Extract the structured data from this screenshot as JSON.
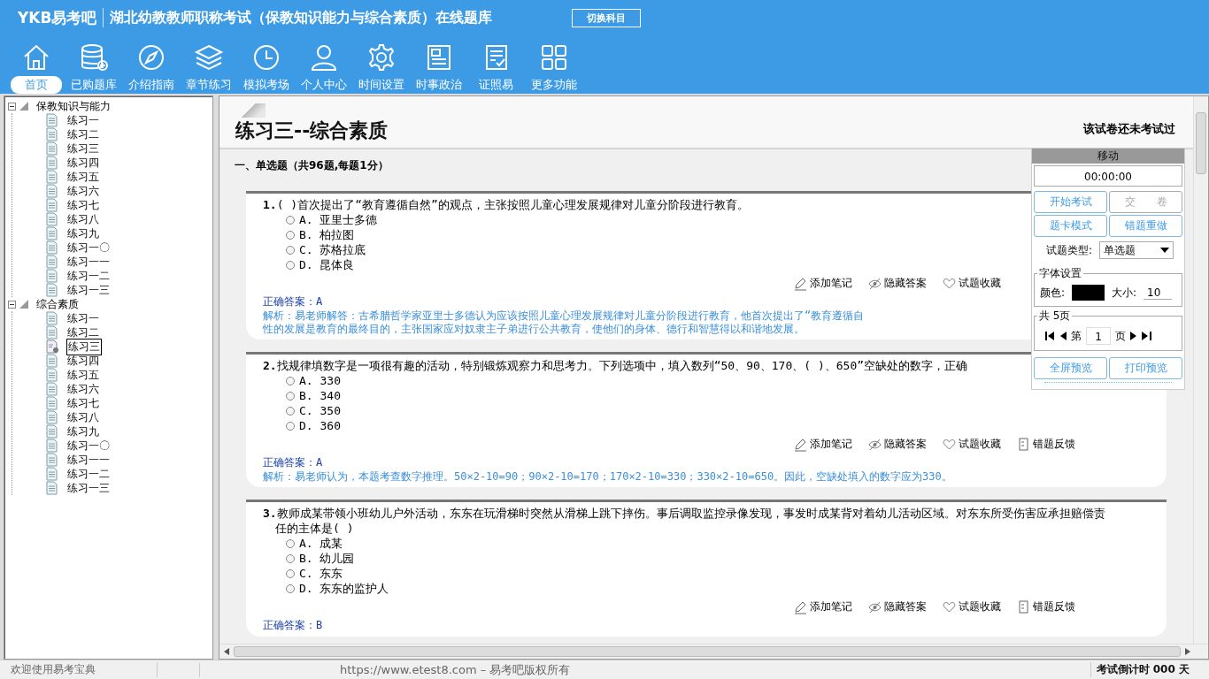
{
  "header": {
    "logo": "YKB易考吧",
    "title": "湖北幼教教师职称考试（保教知识能力与综合素质）在线题库",
    "switch_button": "切换科目"
  },
  "nav": [
    {
      "label": "首页",
      "selected": true
    },
    {
      "label": "已购题库",
      "selected": false
    },
    {
      "label": "介绍指南",
      "selected": false
    },
    {
      "label": "章节练习",
      "selected": false
    },
    {
      "label": "模拟考场",
      "selected": false
    },
    {
      "label": "个人中心",
      "selected": false
    },
    {
      "label": "时间设置",
      "selected": false
    },
    {
      "label": "时事政治",
      "selected": false
    },
    {
      "label": "证照易",
      "selected": false
    },
    {
      "label": "更多功能",
      "selected": false
    }
  ],
  "tree": [
    {
      "label": "保教知识与能力",
      "expanded": true,
      "children": [
        {
          "label": "练习一",
          "selected": false
        },
        {
          "label": "练习二",
          "selected": false
        },
        {
          "label": "练习三",
          "selected": false
        },
        {
          "label": "练习四",
          "selected": false
        },
        {
          "label": "练习五",
          "selected": false
        },
        {
          "label": "练习六",
          "selected": false
        },
        {
          "label": "练习七",
          "selected": false
        },
        {
          "label": "练习八",
          "selected": false
        },
        {
          "label": "练习九",
          "selected": false
        },
        {
          "label": "练习一〇",
          "selected": false
        },
        {
          "label": "练习一一",
          "selected": false
        },
        {
          "label": "练习一二",
          "selected": false
        },
        {
          "label": "练习一三",
          "selected": false
        }
      ]
    },
    {
      "label": "综合素质",
      "expanded": true,
      "children": [
        {
          "label": "练习一",
          "selected": false
        },
        {
          "label": "练习二",
          "selected": false
        },
        {
          "label": "练习三",
          "selected": true
        },
        {
          "label": "练习四",
          "selected": false
        },
        {
          "label": "练习五",
          "selected": false
        },
        {
          "label": "练习六",
          "selected": false
        },
        {
          "label": "练习七",
          "selected": false
        },
        {
          "label": "练习八",
          "selected": false
        },
        {
          "label": "练习九",
          "selected": false
        },
        {
          "label": "练习一〇",
          "selected": false
        },
        {
          "label": "练习一一",
          "selected": false
        },
        {
          "label": "练习一二",
          "selected": false
        },
        {
          "label": "练习一三",
          "selected": false
        }
      ]
    }
  ],
  "paper": {
    "title": "练习三--综合素质",
    "status": "该试卷还未考试过",
    "section": "一、单选题（共96题,每题1分）"
  },
  "questions": [
    {
      "number": "1.",
      "stem": "( )首次提出了“教育遵循自然”的观点，主张按照儿童心理发展规律对儿童分阶段进行教育。",
      "options": [
        {
          "label": "A. 亚里士多德",
          "selected": false
        },
        {
          "label": "B. 柏拉图",
          "selected": false
        },
        {
          "label": "C. 苏格拉底",
          "selected": false
        },
        {
          "label": "D. 昆体良",
          "selected": false
        }
      ],
      "actions": [
        "添加笔记",
        "隐藏答案",
        "试题收藏"
      ],
      "answer": "正确答案：A",
      "analysis": [
        "解析：易老师解答：古希腊哲学家亚里士多德认为应该按照儿童心理发展规律对儿童分阶段进行教育，他首次提出了“教育遵循自",
        "性的发展是教育的最终目的，主张国家应对奴隶主子弟进行公共教育，使他们的身体、德行和智慧得以和谐地发展。"
      ]
    },
    {
      "number": "2.",
      "stem": "找规律填数字是一项很有趣的活动，特别锻炼观察力和思考力。下列选项中，填入数列“50、90、170、( )、650”空缺处的数字，正确",
      "options": [
        {
          "label": "A. 330",
          "selected": false
        },
        {
          "label": "B. 340",
          "selected": false
        },
        {
          "label": "C. 350",
          "selected": false
        },
        {
          "label": "D. 360",
          "selected": false
        }
      ],
      "actions": [
        "添加笔记",
        "隐藏答案",
        "试题收藏",
        "错题反馈"
      ],
      "answer": "正确答案：A",
      "analysis": [
        "解析：易老师认为，本题考查数字推理。50×2-10=90；90×2-10=170；170×2-10=330；330×2-10=650。因此，空缺处填入的数字应为330。"
      ]
    },
    {
      "number": "3.",
      "stem": "教师成某带领小班幼儿户外活动，东东在玩滑梯时突然从滑梯上跳下摔伤。事后调取监控录像发现，事发时成某背对着幼儿活动区域。对东东所受伤害应承担赔偿责任的主体是( )",
      "options": [
        {
          "label": "A. 成某",
          "selected": false
        },
        {
          "label": "B. 幼儿园",
          "selected": false
        },
        {
          "label": "C. 东东",
          "selected": false
        },
        {
          "label": "D. 东东的监护人",
          "selected": false
        }
      ],
      "actions": [
        "添加笔记",
        "隐藏答案",
        "试题收藏",
        "错题反馈"
      ],
      "answer": "正确答案：B"
    }
  ],
  "panel": {
    "title": "移动",
    "timer": "00:00:00",
    "buttons": [
      {
        "label": "开始考试",
        "disabled": false
      },
      {
        "label": "交　　卷",
        "disabled": true
      },
      {
        "label": "题卡模式",
        "disabled": false
      },
      {
        "label": "错题重做",
        "disabled": false
      }
    ],
    "type_label": "试题类型:",
    "type_value": "单选题",
    "font": {
      "legend": "字体设置",
      "color_label": "颜色:",
      "color": "#000000",
      "size_label": "大小:",
      "size": "10"
    },
    "pages": {
      "legend": "共 5页",
      "prefix": "第",
      "page": "1",
      "suffix": "页"
    },
    "preview_buttons": [
      "全屏预览",
      "打印预览"
    ]
  },
  "status_bar": {
    "welcome": "欢迎使用易考宝典",
    "copyright": "https://www.etest8.com – 易考吧版权所有",
    "countdown": "考试倒计时 000 天"
  }
}
